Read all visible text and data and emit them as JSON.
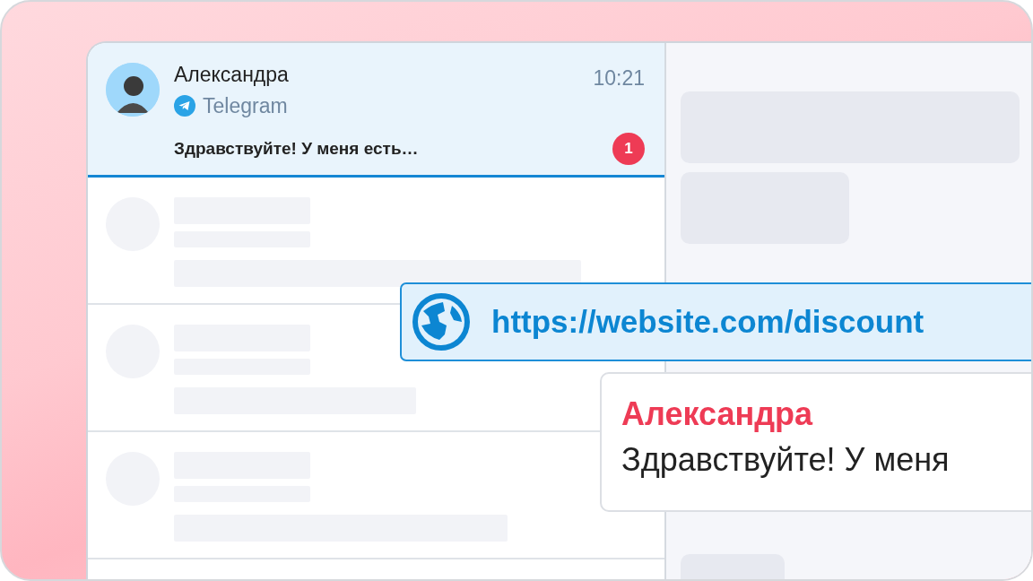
{
  "chat": {
    "name": "Александра",
    "channel": "Telegram",
    "time": "10:21",
    "preview": "Здравствуйте! У меня есть…",
    "unread": "1",
    "selected": true
  },
  "link": {
    "url": "https://website.com/discount"
  },
  "message": {
    "sender": "Александра",
    "text": "Здравствуйте! У меня"
  }
}
